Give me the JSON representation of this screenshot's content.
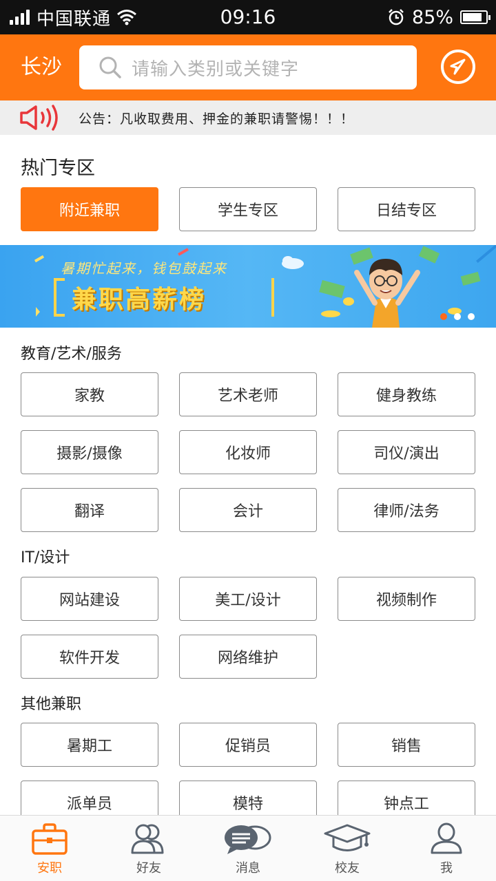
{
  "status_bar": {
    "carrier": "中国联通",
    "time": "09:16",
    "battery_percent": "85%",
    "battery_level": 0.85
  },
  "header": {
    "city": "长沙",
    "search_placeholder": "请输入类别或关键字",
    "locate_icon": "navigation-arrow-icon"
  },
  "notice": {
    "text": "公告：凡收取费用、押金的兼职请警惕！！！"
  },
  "hot_zone": {
    "title": "热门专区",
    "items": [
      "附近兼职",
      "学生专区",
      "日结专区"
    ]
  },
  "banner": {
    "subtitle": "暑期忙起来，钱包鼓起来",
    "title": "兼职高薪榜",
    "slide_count": 3,
    "active_slide": 1
  },
  "categories": [
    {
      "title": "教育/艺术/服务",
      "items": [
        "家教",
        "艺术老师",
        "健身教练",
        "摄影/摄像",
        "化妆师",
        "司仪/演出",
        "翻译",
        "会计",
        "律师/法务"
      ]
    },
    {
      "title": "IT/设计",
      "items": [
        "网站建设",
        "美工/设计",
        "视频制作",
        "软件开发",
        "网络维护"
      ]
    },
    {
      "title": "其他兼职",
      "items": [
        "暑期工",
        "促销员",
        "销售",
        "派单员",
        "模特",
        "钟点工"
      ]
    }
  ],
  "tabbar": [
    {
      "label": "安职",
      "icon": "briefcase-icon"
    },
    {
      "label": "好友",
      "icon": "friends-icon"
    },
    {
      "label": "消息",
      "icon": "message-bubbles-icon"
    },
    {
      "label": "校友",
      "icon": "graduation-cap-icon"
    },
    {
      "label": "我",
      "icon": "person-icon"
    }
  ],
  "colors": {
    "accent": "#ff7610",
    "notice_bg": "#eeeeee",
    "speaker": "#e8363a",
    "tab_icon": "#5a6470"
  }
}
